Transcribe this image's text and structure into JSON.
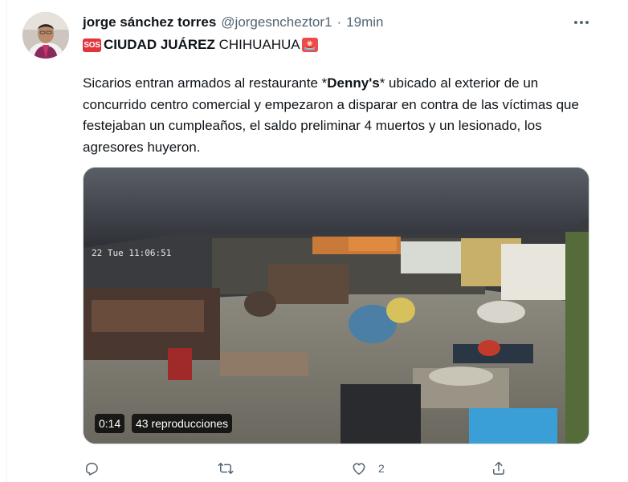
{
  "author": {
    "name": "jorge sánchez torres",
    "handle": "@jorgesncheztor1",
    "separator": "·",
    "time": "19min"
  },
  "headline": {
    "sos_emoji": "SOS",
    "bold_text": "CIUDAD JUÁREZ",
    "regular_text": " CHIHUAHUA",
    "siren_emoji": "🚨"
  },
  "body": {
    "part1": "Sicarios entran armados al restaurante *",
    "brand": "Denny's",
    "part2": "* ubicado al exterior de un concurrido centro comercial y empezaron a disparar en contra de las víctimas que festejaban un cumpleaños, el saldo preliminar 4 muertos y un lesionado, los agresores huyeron."
  },
  "video": {
    "duration": "0:14",
    "views": "43 reproducciones",
    "timestamp_overlay": "22 Tue 11:06:51"
  },
  "actions": {
    "reply_icon": "reply-icon",
    "retweet_icon": "retweet-icon",
    "like_icon": "heart-icon",
    "like_count": "2",
    "share_icon": "share-icon"
  },
  "colors": {
    "text": "#0f1419",
    "secondary": "#536471",
    "emoji_red": "#e0353b",
    "border": "#cfd9de"
  }
}
